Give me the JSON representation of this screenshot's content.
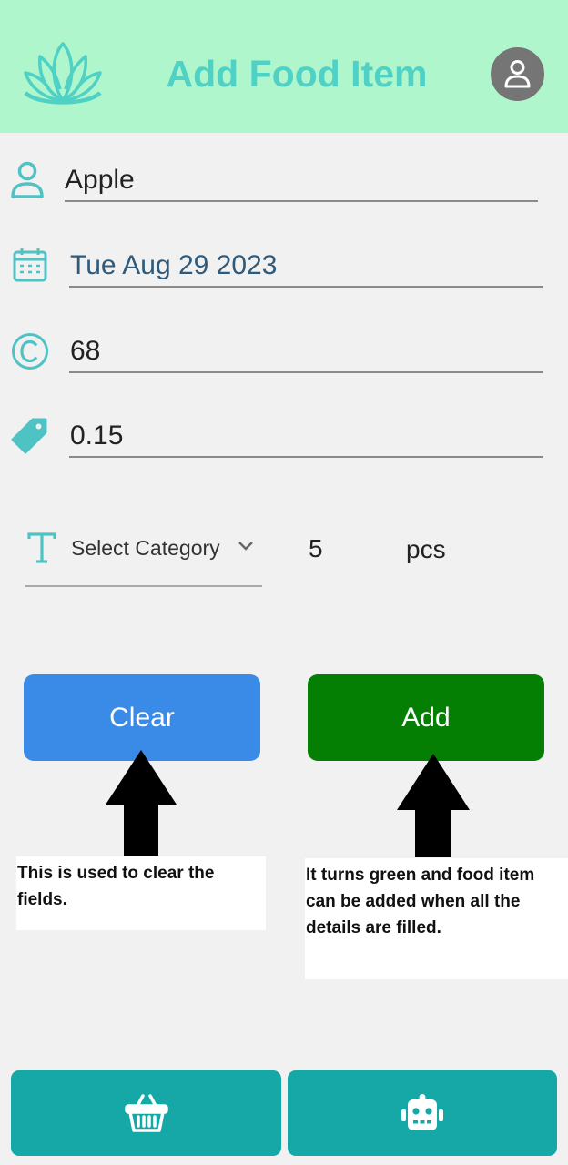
{
  "header": {
    "title": "Add Food Item"
  },
  "form": {
    "name": "Apple",
    "date": "Tue Aug 29 2023",
    "calories": "68",
    "price": "0.15",
    "category_placeholder": "Select Category",
    "quantity": "5",
    "unit": "pcs"
  },
  "buttons": {
    "clear": "Clear",
    "add": "Add"
  },
  "notes": {
    "clear": "This is used to clear the fields.",
    "add": "It turns green and food item can be added when all the details are filled."
  },
  "bottom_nav": {
    "items": [
      "basket-icon",
      "robot-icon"
    ]
  },
  "colors": {
    "header_bg": "#aff6cc",
    "accent": "#4fd1c5",
    "clear_btn": "#3a8ae7",
    "add_btn": "#047f04",
    "nav_bg": "#16a8a6"
  }
}
